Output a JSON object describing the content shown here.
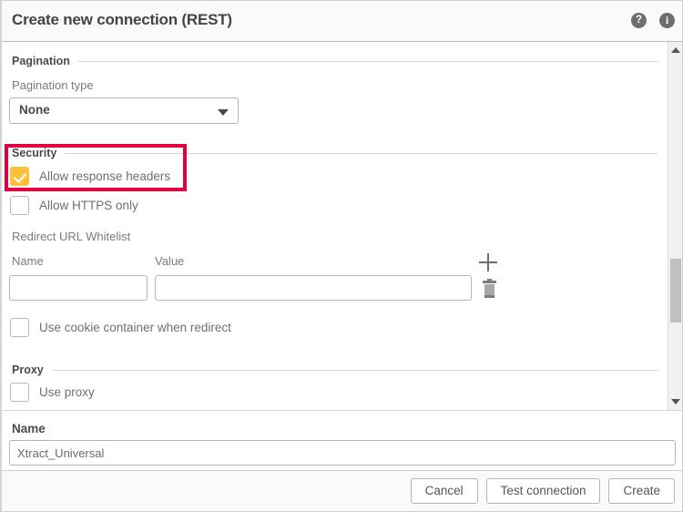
{
  "dialog": {
    "title": "Create new connection (REST)",
    "help_icon": "help-circle-icon",
    "info_icon": "info-circle-icon",
    "help_glyph": "?",
    "info_glyph": "i"
  },
  "sections": {
    "pagination": {
      "heading": "Pagination",
      "type_label": "Pagination type",
      "type_value": "None",
      "type_options": [
        "None"
      ]
    },
    "security": {
      "heading": "Security",
      "allow_response_headers": {
        "label": "Allow response headers",
        "checked": true
      },
      "allow_https_only": {
        "label": "Allow HTTPS only",
        "checked": false
      }
    },
    "redirect_whitelist": {
      "heading": "Redirect URL Whitelist",
      "col_name": "Name",
      "col_value": "Value",
      "add_icon": "plus-icon",
      "delete_icon": "trash-icon",
      "rows": [
        {
          "name": "",
          "value": ""
        }
      ],
      "use_cookie_container": {
        "label": "Use cookie container when redirect",
        "checked": false
      }
    },
    "proxy": {
      "heading": "Proxy",
      "use_proxy": {
        "label": "Use proxy",
        "checked": false
      }
    }
  },
  "name_panel": {
    "heading": "Name",
    "value": "Xtract_Universal"
  },
  "footer": {
    "cancel_label": "Cancel",
    "test_label": "Test connection",
    "create_label": "Create"
  },
  "scrollbar": {
    "up_icon": "caret-up-icon",
    "down_icon": "caret-down-icon"
  },
  "highlight": {
    "color": "#e4003f",
    "target": "allow-response-headers-row"
  }
}
